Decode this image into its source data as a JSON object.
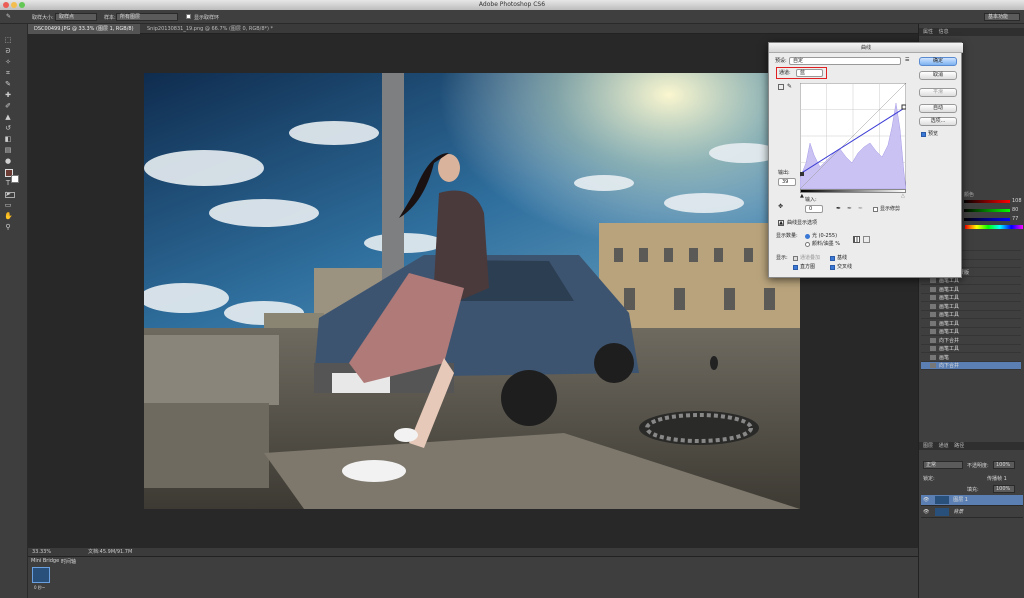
{
  "app": {
    "title": "Adobe Photoshop CS6",
    "workspace": "基本功能"
  },
  "options_bar": {
    "label_size": "取样大小:",
    "size_value": "取样点",
    "label_sample": "样本:",
    "sample_value": "所有图层",
    "show_ring": "显示取样环"
  },
  "tabs": [
    {
      "label": "DSC00499.JPG @ 33.3% (图层 1, RGB/8) *"
    },
    {
      "label": "Snip20130831_19.png @ 66.7% (图层 0, RGB/8*) *"
    }
  ],
  "status": {
    "zoom": "33.33%",
    "doc": "文档:45.9M/91.7M"
  },
  "mini_bridge": {
    "tab1": "Mini Bridge",
    "tab2": "时间轴",
    "thumb_label": "0 秒~"
  },
  "right_panel": {
    "top_tabs": [
      "属性",
      "信息"
    ],
    "small_labels": [
      "调整",
      "样式",
      "色板",
      "颜色",
      "路径"
    ],
    "color_values": {
      "r": "108",
      "g": "80",
      "b": "77"
    },
    "history_items": [
      "向下合并",
      "复制图层",
      "曲线",
      "添加图层蒙版",
      "画笔工具",
      "画笔工具",
      "画笔工具",
      "画笔工具",
      "画笔工具",
      "画笔工具",
      "画笔工具",
      "向下合并",
      "画笔工具",
      "画笔",
      "向下合并"
    ],
    "layers_tabs": [
      "图层",
      "通道",
      "路径"
    ],
    "blend_mode": "正常",
    "opacity_label": "不透明度:",
    "opacity": "100%",
    "lock_label": "锁定:",
    "fill_label": "填充:",
    "fill": "100%",
    "propagate_label": "传播帧 1",
    "layers": [
      {
        "name": "图层 1"
      },
      {
        "name": "背景"
      }
    ]
  },
  "curves_dialog": {
    "title": "曲线",
    "preset_label": "预设:",
    "preset_value": "自定",
    "channel_label": "通道:",
    "channel_value": "蓝",
    "output_label": "输出:",
    "output_value": "39",
    "input_label": "输入:",
    "input_value": "0",
    "buttons": {
      "ok": "确定",
      "cancel": "取消",
      "smooth": "平滑",
      "auto": "自动",
      "options": "选项..."
    },
    "preview_label": "预览",
    "show_clipping": "显示修剪",
    "curve_display_options": "曲线显示选项",
    "show_amount": "显示数量:",
    "light_option": "光 (0-255)",
    "pigment_option": "颜料/油墨 %",
    "show_label": "显示:",
    "channel_overlays": "通道叠加",
    "baseline": "基线",
    "histogram": "直方图",
    "intersection": "交叉线"
  },
  "colors": {
    "accent": "#3a78d6",
    "highlight_box": "#e02020",
    "histogram": "#c9c2f2",
    "curve_line": "#3b3bd6"
  }
}
